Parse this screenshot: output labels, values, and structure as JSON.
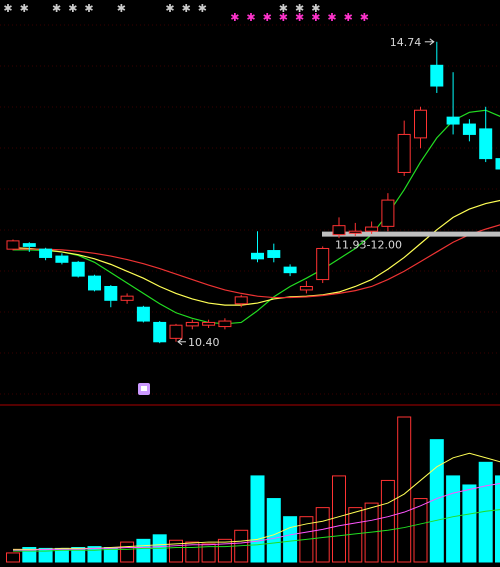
{
  "chart_data": {
    "type": "candlestick",
    "price_range": [
      9.5,
      15.2
    ],
    "volume_range": [
      0,
      160
    ],
    "candles": [
      {
        "o": 11.74,
        "c": 11.86,
        "h": 11.88,
        "l": 11.72,
        "v": 10
      },
      {
        "o": 11.82,
        "c": 11.78,
        "h": 11.84,
        "l": 11.7,
        "v": 16
      },
      {
        "o": 11.74,
        "c": 11.62,
        "h": 11.76,
        "l": 11.58,
        "v": 15
      },
      {
        "o": 11.64,
        "c": 11.55,
        "h": 11.68,
        "l": 11.52,
        "v": 15
      },
      {
        "o": 11.55,
        "c": 11.35,
        "h": 11.57,
        "l": 11.33,
        "v": 16
      },
      {
        "o": 11.35,
        "c": 11.15,
        "h": 11.37,
        "l": 11.13,
        "v": 17
      },
      {
        "o": 11.2,
        "c": 11.0,
        "h": 11.22,
        "l": 10.9,
        "v": 16
      },
      {
        "o": 11.0,
        "c": 11.06,
        "h": 11.1,
        "l": 10.95,
        "v": 22
      },
      {
        "o": 10.9,
        "c": 10.7,
        "h": 10.92,
        "l": 10.68,
        "v": 25
      },
      {
        "o": 10.68,
        "c": 10.4,
        "h": 10.7,
        "l": 10.38,
        "v": 30
      },
      {
        "o": 10.45,
        "c": 10.64,
        "h": 10.66,
        "l": 10.4,
        "v": 24
      },
      {
        "o": 10.63,
        "c": 10.68,
        "h": 10.72,
        "l": 10.58,
        "v": 22
      },
      {
        "o": 10.64,
        "c": 10.68,
        "h": 10.72,
        "l": 10.6,
        "v": 20
      },
      {
        "o": 10.62,
        "c": 10.7,
        "h": 10.74,
        "l": 10.58,
        "v": 25
      },
      {
        "o": 10.95,
        "c": 11.05,
        "h": 11.08,
        "l": 10.9,
        "v": 35
      },
      {
        "o": 11.68,
        "c": 11.6,
        "h": 12.0,
        "l": 11.55,
        "v": 95
      },
      {
        "o": 11.72,
        "c": 11.62,
        "h": 11.82,
        "l": 11.55,
        "v": 70
      },
      {
        "o": 11.48,
        "c": 11.4,
        "h": 11.52,
        "l": 11.35,
        "v": 50
      },
      {
        "o": 11.15,
        "c": 11.2,
        "h": 11.28,
        "l": 11.1,
        "v": 50
      },
      {
        "o": 11.3,
        "c": 11.75,
        "h": 11.78,
        "l": 11.25,
        "v": 60
      },
      {
        "o": 11.95,
        "c": 12.08,
        "h": 12.2,
        "l": 11.9,
        "v": 95
      },
      {
        "o": 11.97,
        "c": 12.0,
        "h": 12.12,
        "l": 11.93,
        "v": 60
      },
      {
        "o": 12.0,
        "c": 12.06,
        "h": 12.14,
        "l": 11.96,
        "v": 65
      },
      {
        "o": 12.07,
        "c": 12.45,
        "h": 12.55,
        "l": 12.0,
        "v": 90
      },
      {
        "o": 12.85,
        "c": 13.4,
        "h": 13.6,
        "l": 12.8,
        "v": 160
      },
      {
        "o": 13.35,
        "c": 13.75,
        "h": 13.8,
        "l": 13.2,
        "v": 70
      },
      {
        "o": 14.4,
        "c": 14.1,
        "h": 14.74,
        "l": 14.0,
        "v": 135
      },
      {
        "o": 13.65,
        "c": 13.55,
        "h": 14.3,
        "l": 13.4,
        "v": 95
      },
      {
        "o": 13.55,
        "c": 13.4,
        "h": 13.62,
        "l": 13.3,
        "v": 85
      },
      {
        "o": 13.48,
        "c": 13.05,
        "h": 13.8,
        "l": 13.0,
        "v": 110
      },
      {
        "o": 13.05,
        "c": 12.9,
        "h": 13.1,
        "l": 12.85,
        "v": 95
      }
    ],
    "moving_averages": [
      {
        "color": "#22dd22",
        "values": [
          11.73,
          11.73,
          11.72,
          11.7,
          11.65,
          11.55,
          11.4,
          11.25,
          11.1,
          10.95,
          10.82,
          10.74,
          10.68,
          10.66,
          10.68,
          10.85,
          11.05,
          11.2,
          11.32,
          11.45,
          11.6,
          11.75,
          11.95,
          12.25,
          12.6,
          13.0,
          13.35,
          13.6,
          13.72,
          13.75,
          13.65
        ]
      },
      {
        "color": "#ffff55",
        "values": [
          11.76,
          11.75,
          11.73,
          11.7,
          11.66,
          11.6,
          11.52,
          11.42,
          11.32,
          11.2,
          11.1,
          11.02,
          10.96,
          10.93,
          10.93,
          10.96,
          11.02,
          11.05,
          11.06,
          11.08,
          11.12,
          11.2,
          11.3,
          11.45,
          11.62,
          11.82,
          12.02,
          12.2,
          12.32,
          12.4,
          12.45
        ]
      },
      {
        "color": "#ee3333",
        "values": [
          11.74,
          11.74,
          11.74,
          11.73,
          11.71,
          11.68,
          11.64,
          11.59,
          11.53,
          11.46,
          11.38,
          11.3,
          11.22,
          11.15,
          11.1,
          11.06,
          11.04,
          11.04,
          11.05,
          11.07,
          11.1,
          11.14,
          11.2,
          11.3,
          11.42,
          11.56,
          11.7,
          11.84,
          11.95,
          12.03,
          12.1
        ]
      }
    ],
    "volume_averages": [
      {
        "color": "#ffff55",
        "values": [
          14,
          14,
          14,
          15,
          15,
          15,
          16,
          17,
          18,
          19,
          20,
          21,
          22,
          22,
          23,
          25,
          30,
          38,
          42,
          45,
          50,
          55,
          60,
          65,
          75,
          90,
          105,
          115,
          120,
          115,
          110
        ]
      },
      {
        "color": "#ff55ff",
        "values": [
          13,
          13,
          14,
          14,
          14,
          15,
          15,
          16,
          16,
          17,
          18,
          19,
          19,
          20,
          21,
          23,
          26,
          30,
          33,
          36,
          40,
          43,
          46,
          50,
          55,
          62,
          70,
          76,
          80,
          84,
          87
        ]
      },
      {
        "color": "#22dd22",
        "values": [
          12,
          12,
          12,
          13,
          13,
          13,
          14,
          14,
          15,
          15,
          16,
          16,
          17,
          17,
          18,
          19,
          21,
          23,
          25,
          27,
          29,
          31,
          33,
          35,
          38,
          42,
          46,
          50,
          53,
          56,
          58
        ]
      }
    ],
    "annotations": {
      "high": {
        "value": 14.74,
        "label": "14.74"
      },
      "low": {
        "value": 10.4,
        "label": "10.40"
      },
      "zone": {
        "low": 11.93,
        "high": 12.0,
        "label": "11.93-12.00"
      }
    },
    "top_markers": [
      {
        "color": "#cccccc",
        "slots": [
          0,
          1,
          3,
          4,
          5,
          7,
          10,
          11,
          12,
          17,
          18,
          19
        ]
      },
      {
        "color": "#ff33cc",
        "slots": [
          14,
          15,
          16,
          17,
          18,
          19,
          20,
          21,
          22
        ]
      }
    ],
    "badge": {
      "color": "#cc99ff"
    }
  }
}
